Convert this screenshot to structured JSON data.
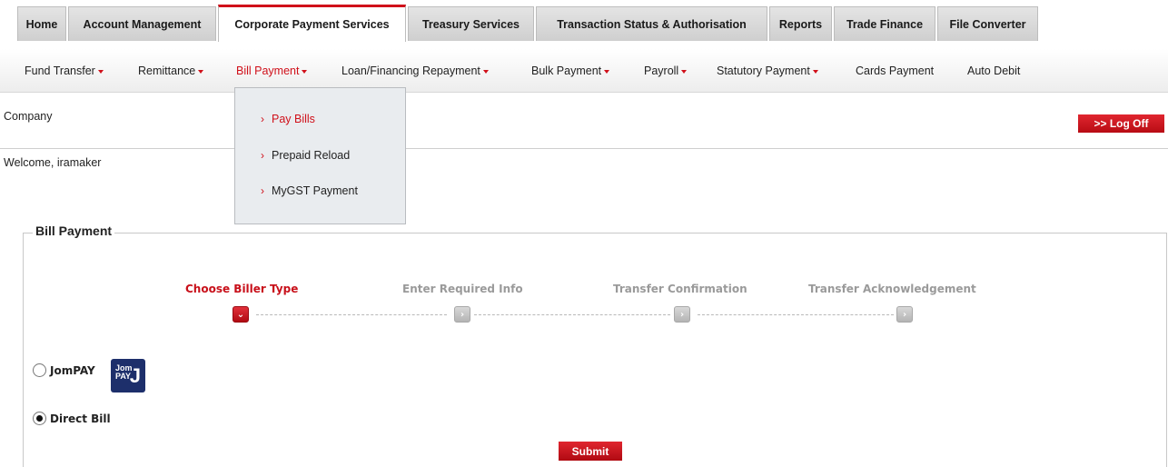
{
  "main_tabs": [
    {
      "label": "Home"
    },
    {
      "label": "Account Management"
    },
    {
      "label": "Corporate Payment Services"
    },
    {
      "label": "Treasury Services"
    },
    {
      "label": "Transaction Status & Authorisation"
    },
    {
      "label": "Reports"
    },
    {
      "label": "Trade Finance"
    },
    {
      "label": "File Converter"
    }
  ],
  "sub_nav": [
    {
      "label": "Fund Transfer"
    },
    {
      "label": "Remittance"
    },
    {
      "label": "Bill Payment"
    },
    {
      "label": "Loan/Financing Repayment"
    },
    {
      "label": "Bulk Payment"
    },
    {
      "label": "Payroll"
    },
    {
      "label": "Statutory Payment"
    },
    {
      "label": "Cards Payment"
    },
    {
      "label": "Auto Debit"
    }
  ],
  "dropdown": [
    {
      "label": "Pay Bills"
    },
    {
      "label": "Prepaid Reload"
    },
    {
      "label": "MyGST Payment"
    }
  ],
  "header": {
    "company_label": "Company",
    "logoff_label": ">> Log Off",
    "welcome": "Welcome, iramaker"
  },
  "form": {
    "legend": "Bill Payment",
    "steps": [
      {
        "label": "Choose Biller Type"
      },
      {
        "label": "Enter Required Info"
      },
      {
        "label": "Transfer Confirmation"
      },
      {
        "label": "Transfer Acknowledgement"
      }
    ],
    "options": [
      {
        "label": "JomPAY",
        "checked": false
      },
      {
        "label": "Direct Bill",
        "checked": true
      }
    ],
    "jompay_logo_text": "Jom PAY",
    "submit_label": "Submit"
  },
  "colors": {
    "accent": "#d0101a",
    "tab_bg": "#d8d8d8",
    "dropdown_bg": "#e9ecef"
  }
}
